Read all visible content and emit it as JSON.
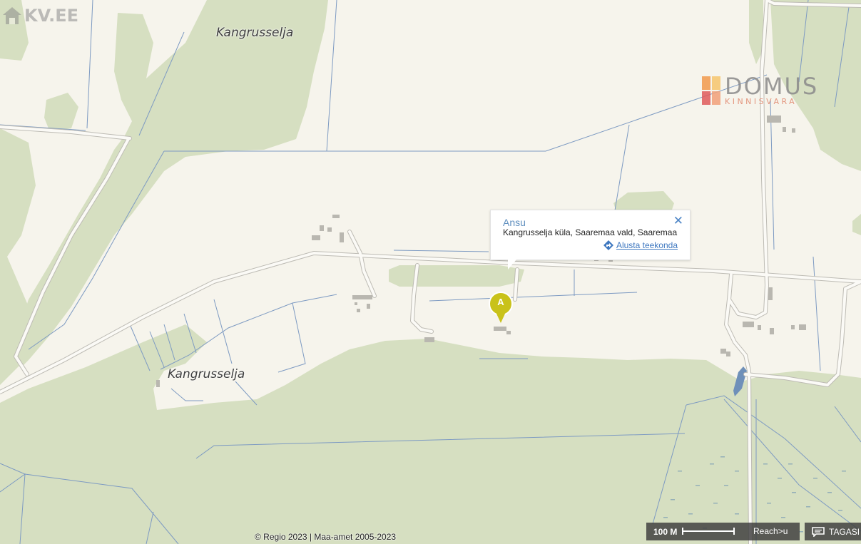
{
  "map": {
    "place_labels": [
      "Kangrusselja",
      "Kangrusselja"
    ],
    "copyright": "© Regio 2023 | Maa-amet 2005-2023"
  },
  "logos": {
    "kv": "KV.EE",
    "domus_name": "DOMUS",
    "domus_sub": "KINNISVARA"
  },
  "popup": {
    "title": "Ansu",
    "address": "Kangrusselja küla, Saaremaa vald, Saaremaa",
    "route_label": "Alusta teekonda",
    "close_icon": "close-icon",
    "route_icon": "directions-icon"
  },
  "marker": {
    "label": "A",
    "color": "#c9c21a"
  },
  "controls": {
    "scale_label": "100 M",
    "reach_label": "Reach>u",
    "back_label": "TAGASI",
    "back_icon": "chat-bubble-icon"
  },
  "colors": {
    "land": "#f6f4ec",
    "forest": "#d6dfc1",
    "water": "#6f90b9",
    "ditch": "#7d9ac2"
  }
}
